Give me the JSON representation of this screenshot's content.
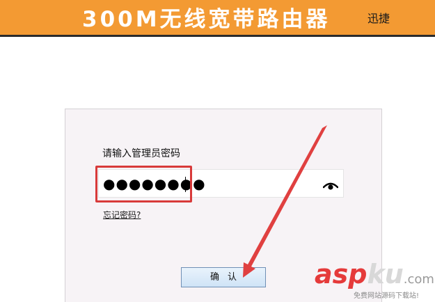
{
  "header": {
    "title": "300M无线宽带路由器",
    "brand": "迅捷"
  },
  "login": {
    "prompt": "请输入管理员密码",
    "password_masked": "●●●●●●●●",
    "forgot_link": "忘记密码?",
    "confirm_label": "确认"
  },
  "watermark": {
    "asp": "asp",
    "ku": "ku",
    "com": ".com",
    "subtitle": "免费网站源码下载站!"
  },
  "colors": {
    "header_bg": "#f39a33",
    "highlight": "#d83a3a",
    "arrow": "#e04040"
  },
  "icons": {
    "eye": "eye-icon",
    "arrow": "red-arrow-annotation"
  }
}
